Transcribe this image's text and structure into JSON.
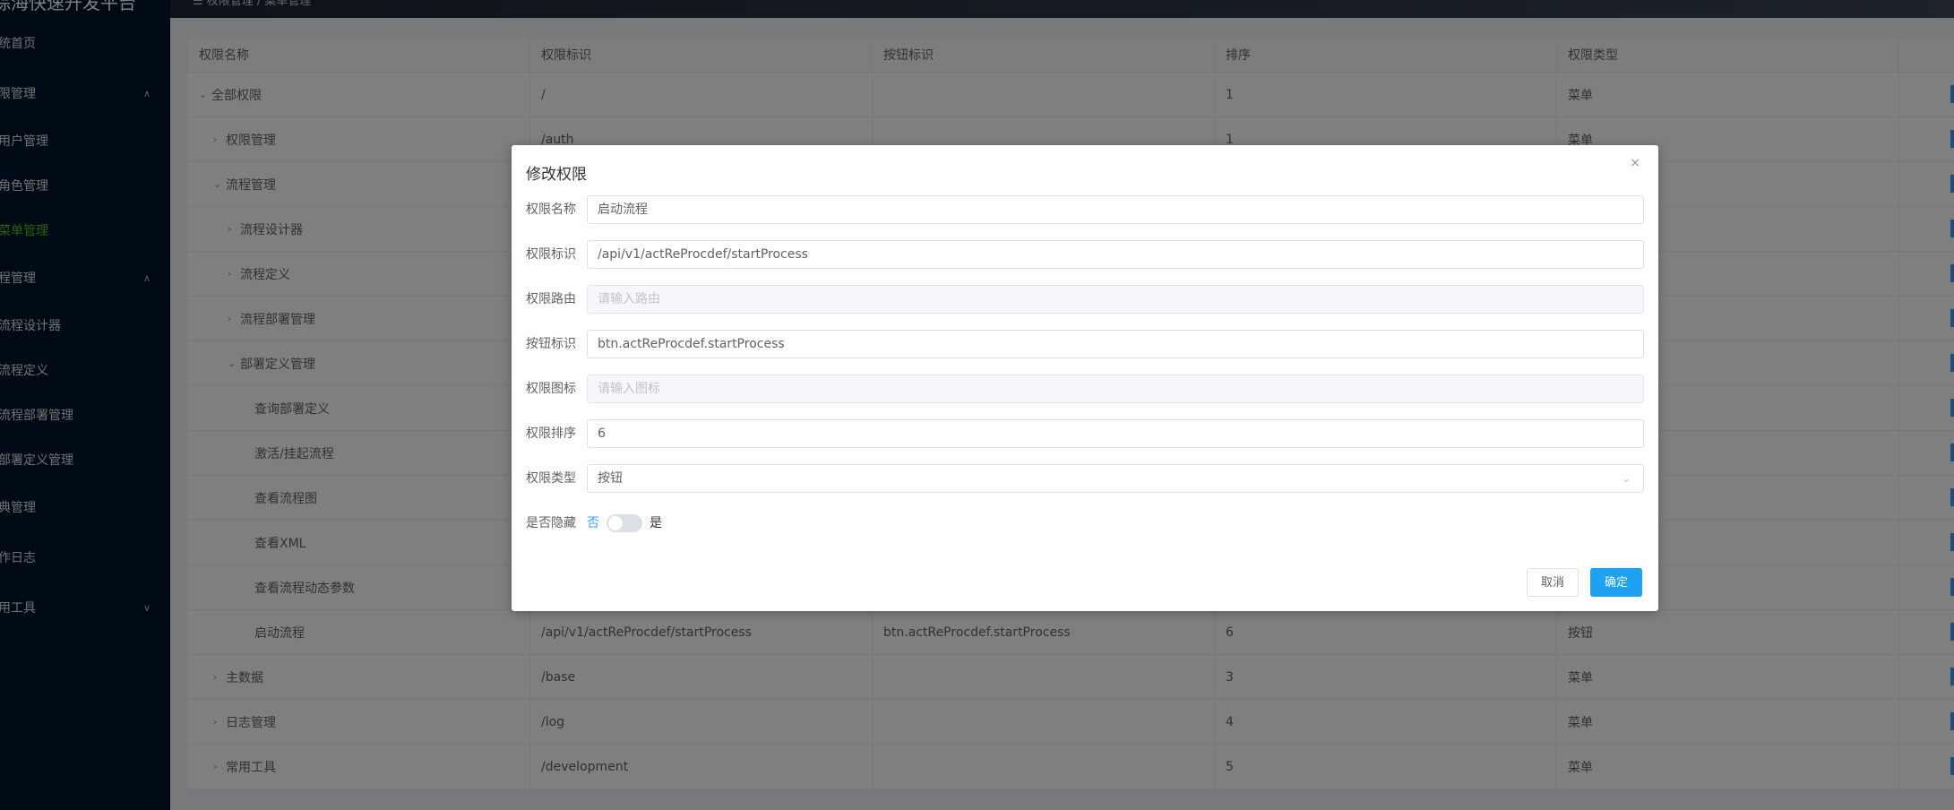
{
  "sidebar": {
    "logo": "综海快速开发平台",
    "items": [
      {
        "label": "统首页",
        "arrow": ""
      },
      {
        "label": "限管理",
        "arrow": "∧"
      },
      {
        "label": "用户管理",
        "arrow": ""
      },
      {
        "label": "角色管理",
        "arrow": ""
      },
      {
        "label": "菜单管理",
        "arrow": ""
      },
      {
        "label": "程管理",
        "arrow": "∧"
      },
      {
        "label": "流程设计器",
        "arrow": ""
      },
      {
        "label": "流程定义",
        "arrow": ""
      },
      {
        "label": "流程部署管理",
        "arrow": ""
      },
      {
        "label": "部署定义管理",
        "arrow": ""
      },
      {
        "label": "典管理",
        "arrow": ""
      },
      {
        "label": "作日志",
        "arrow": ""
      },
      {
        "label": "用工具",
        "arrow": "∨"
      }
    ]
  },
  "header": {
    "breadcrumb": "☰ 权限管理 / 菜单管理"
  },
  "table": {
    "headers": [
      "权限名称",
      "权限标识",
      "按钮标识",
      "排序",
      "权限类型",
      ""
    ],
    "rows": [
      {
        "name": "全部权限",
        "arrow": "⌄",
        "code": "/",
        "button": "",
        "sort": "1",
        "type": "菜单"
      },
      {
        "name": "权限管理",
        "arrow": "›",
        "code": "/auth",
        "button": "",
        "sort": "1",
        "type": "菜单"
      },
      {
        "name": "流程管理",
        "arrow": "⌄",
        "code": "",
        "button": "",
        "sort": "",
        "type": ""
      },
      {
        "name": "流程设计器",
        "arrow": "›",
        "code": "",
        "button": "",
        "sort": "",
        "type": ""
      },
      {
        "name": "流程定义",
        "arrow": "›",
        "code": "",
        "button": "",
        "sort": "",
        "type": ""
      },
      {
        "name": "流程部署管理",
        "arrow": "›",
        "code": "",
        "button": "",
        "sort": "",
        "type": ""
      },
      {
        "name": "部署定义管理",
        "arrow": "⌄",
        "code": "",
        "button": "",
        "sort": "",
        "type": ""
      },
      {
        "name": "查询部署定义",
        "arrow": "",
        "code": "",
        "button": "",
        "sort": "",
        "type": ""
      },
      {
        "name": "激活/挂起流程",
        "arrow": "",
        "code": "",
        "button": "",
        "sort": "",
        "type": ""
      },
      {
        "name": "查看流程图",
        "arrow": "",
        "code": "",
        "button": "",
        "sort": "",
        "type": ""
      },
      {
        "name": "查看XML",
        "arrow": "",
        "code": "",
        "button": "",
        "sort": "",
        "type": ""
      },
      {
        "name": "查看流程动态参数",
        "arrow": "",
        "code": "",
        "button": "",
        "sort": "",
        "type": ""
      },
      {
        "name": "启动流程",
        "arrow": "",
        "code": "/api/v1/actReProcdef/startProcess",
        "button": "btn.actReProcdef.startProcess",
        "sort": "6",
        "type": "按钮"
      },
      {
        "name": "主数据",
        "arrow": "›",
        "code": "/base",
        "button": "",
        "sort": "3",
        "type": "菜单"
      },
      {
        "name": "日志管理",
        "arrow": "›",
        "code": "/log",
        "button": "",
        "sort": "4",
        "type": "菜单"
      },
      {
        "name": "常用工具",
        "arrow": "›",
        "code": "/development",
        "button": "",
        "sort": "5",
        "type": "菜单"
      }
    ]
  },
  "dialog": {
    "title": "修改权限",
    "close_icon": "×",
    "fields": {
      "name": {
        "label": "权限名称",
        "value": "启动流程",
        "placeholder": ""
      },
      "code": {
        "label": "权限标识",
        "value": "/api/v1/actReProcdef/startProcess",
        "placeholder": ""
      },
      "route": {
        "label": "权限路由",
        "value": "",
        "placeholder": "请输入路由"
      },
      "button": {
        "label": "按钮标识",
        "value": "btn.actReProcdef.startProcess",
        "placeholder": ""
      },
      "icon": {
        "label": "权限图标",
        "value": "",
        "placeholder": "请输入图标"
      },
      "sort": {
        "label": "权限排序",
        "value": "6",
        "placeholder": ""
      },
      "type": {
        "label": "权限类型",
        "value": "按钮",
        "caret": "⌄"
      }
    },
    "hidden": {
      "label": "是否隐藏",
      "off_text": "否",
      "on_text": "是",
      "checked": false
    },
    "cancel_label": "取消",
    "ok_label": "确定"
  },
  "colors": {
    "accent": "#409eff",
    "primary_button": "#1da1f2",
    "sidebar_bg": "#001529",
    "active_menu": "#52c41a"
  }
}
